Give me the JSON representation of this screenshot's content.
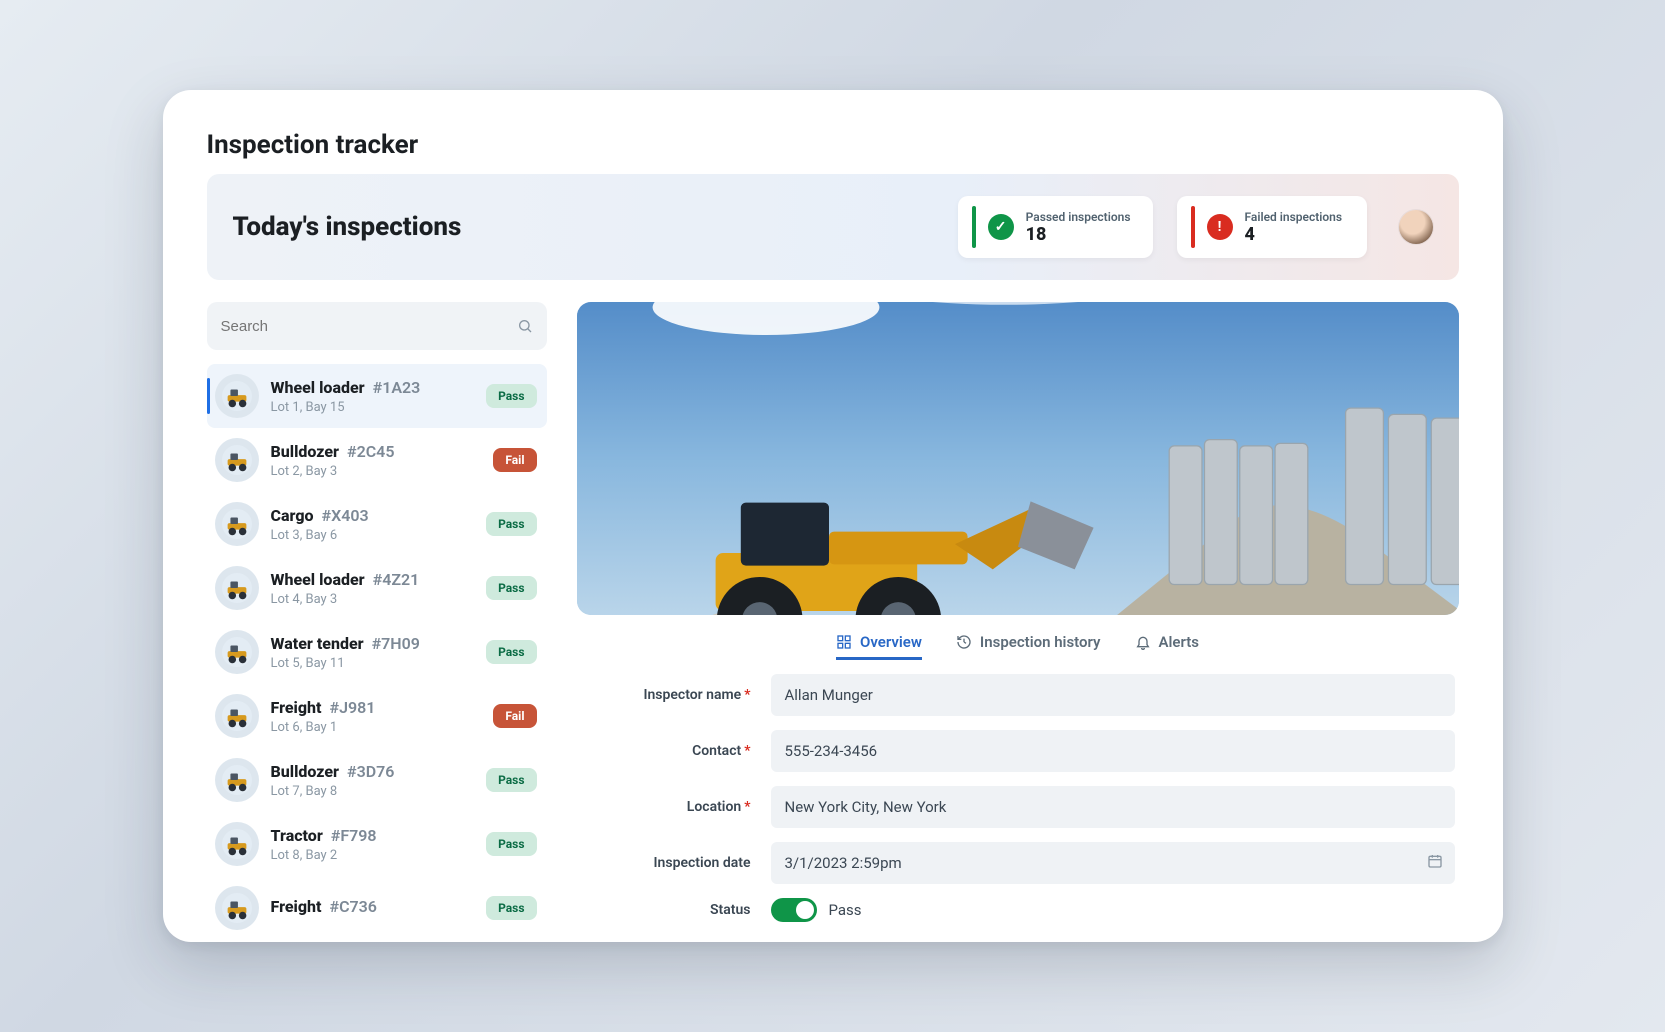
{
  "page_title": "Inspection tracker",
  "banner": {
    "title": "Today's inspections"
  },
  "stats": {
    "passed": {
      "label": "Passed inspections",
      "value": "18"
    },
    "failed": {
      "label": "Failed inspections",
      "value": "4"
    }
  },
  "search": {
    "placeholder": "Search"
  },
  "items": [
    {
      "name": "Wheel loader",
      "code": "#1A23",
      "sub": "Lot 1, Bay 15",
      "status_label": "Pass",
      "status": "pass",
      "selected": true
    },
    {
      "name": "Bulldozer",
      "code": "#2C45",
      "sub": "Lot 2, Bay 3",
      "status_label": "Fail",
      "status": "fail",
      "selected": false
    },
    {
      "name": "Cargo",
      "code": "#X403",
      "sub": "Lot 3, Bay 6",
      "status_label": "Pass",
      "status": "pass",
      "selected": false
    },
    {
      "name": "Wheel loader",
      "code": "#4Z21",
      "sub": "Lot 4, Bay 3",
      "status_label": "Pass",
      "status": "pass",
      "selected": false
    },
    {
      "name": "Water tender",
      "code": "#7H09",
      "sub": "Lot 5, Bay 11",
      "status_label": "Pass",
      "status": "pass",
      "selected": false
    },
    {
      "name": "Freight",
      "code": "#J981",
      "sub": "Lot 6, Bay 1",
      "status_label": "Fail",
      "status": "fail",
      "selected": false
    },
    {
      "name": "Bulldozer",
      "code": "#3D76",
      "sub": "Lot 7, Bay 8",
      "status_label": "Pass",
      "status": "pass",
      "selected": false
    },
    {
      "name": "Tractor",
      "code": "#F798",
      "sub": "Lot 8, Bay 2",
      "status_label": "Pass",
      "status": "pass",
      "selected": false
    },
    {
      "name": "Freight",
      "code": "#C736",
      "sub": "",
      "status_label": "Pass",
      "status": "pass",
      "selected": false
    }
  ],
  "tabs": {
    "overview": "Overview",
    "history": "Inspection history",
    "alerts": "Alerts"
  },
  "form": {
    "inspector_label": "Inspector name",
    "inspector_value": "Allan Munger",
    "contact_label": "Contact",
    "contact_value": "555-234-3456",
    "location_label": "Location",
    "location_value": "New York City, New York",
    "date_label": "Inspection date",
    "date_value": "3/1/2023 2:59pm",
    "status_label": "Status",
    "status_value": "Pass"
  }
}
